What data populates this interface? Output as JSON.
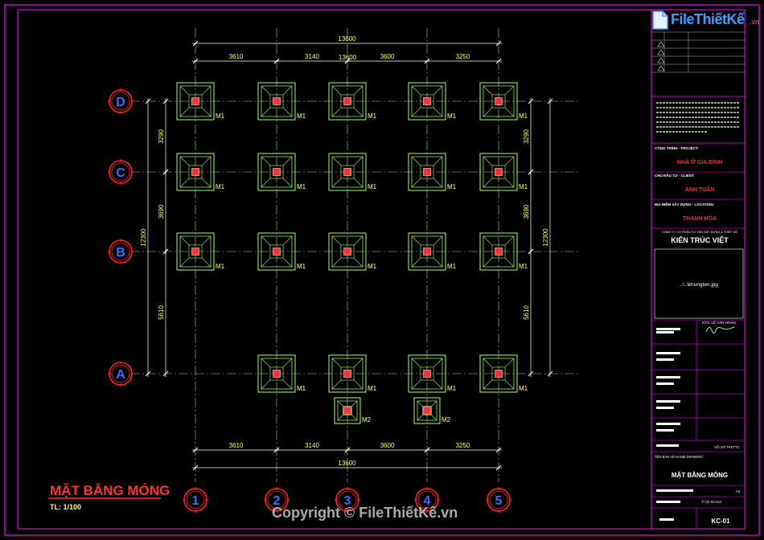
{
  "drawing": {
    "title": "MẶT BẰNG MÓNG",
    "scale": "TL: 1/100",
    "dims_top_total": "13600",
    "dims_top_segments": [
      "3610",
      "3140",
      "3600",
      "3250"
    ],
    "dims_top_mid": "13600",
    "dims_bottom_total": "13600",
    "dims_bottom_segments": [
      "3610",
      "3140",
      "3600",
      "3250"
    ],
    "dims_side_total": "12300",
    "dims_side_segments": [
      "3290",
      "3690",
      "5610"
    ],
    "grid_rows": [
      "D",
      "C",
      "B",
      "A"
    ],
    "grid_cols": [
      "1",
      "2",
      "3",
      "4",
      "5"
    ],
    "footing_labels": {
      "m1": "M1",
      "m2": "M2"
    }
  },
  "title_block": {
    "project_label": "CÔNG TRÌNH - PROJECT:",
    "project_name": "NHÀ Ở GIA ĐÌNH",
    "client_label": "CHỦ ĐẦU TƯ - CLIENT:",
    "client_name": "ANH TUẤN",
    "location_label": "ĐỊA ĐIỂM XÂY DỰNG - LOCATION:",
    "location_name": "THANH HÓA",
    "company_label": "CÔNG TY CỔ PHẦN TƯ VẤN XÂY DỰNG & THIẾT KẾ",
    "company_name": "KIẾN TRÚC VIỆT",
    "image_placeholder": "..\\..\\khungten.jpg",
    "designer": "KTS. LÊ VĂN HOÀN",
    "drawing_name_label": "TÊN BẢN VẼ-NAME DRAWING:",
    "drawing_name": "MẶT BẰNG MÓNG",
    "sheet_no": "KC-01",
    "stage": "HỒ SƠ TKKTTC",
    "scale_value": "A3",
    "ratio_label": "TỈ LỆ-SCALE:"
  },
  "watermark": {
    "brand": "FileThiếtKế",
    "tld": ".vn",
    "copyright": "Copyright © FileThiếtKế.vn"
  },
  "colors": {
    "border": "#ff00ff",
    "dim": "#ffffff",
    "dim_text": "#ffff66",
    "footing": "#aaff66",
    "column": "#ff3333",
    "bubble": "#ff2020",
    "bubble_text": "#3b6bff",
    "title": "#ff3030",
    "title_block_red": "#ff2a2a"
  }
}
